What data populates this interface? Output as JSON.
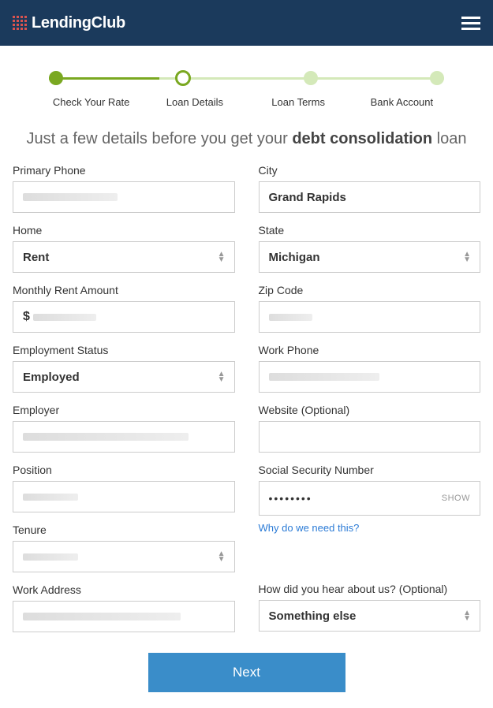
{
  "header": {
    "brand": "LendingClub"
  },
  "progress": {
    "steps": [
      "Check Your Rate",
      "Loan Details",
      "Loan Terms",
      "Bank Account"
    ]
  },
  "heading": {
    "prefix": "Just a few details before you get your ",
    "bold": "debt consolidation",
    "suffix": " loan"
  },
  "left": {
    "phone_label": "Primary Phone",
    "home_label": "Home",
    "home_value": "Rent",
    "rent_label": "Monthly Rent Amount",
    "rent_prefix": "$",
    "emp_status_label": "Employment Status",
    "emp_status_value": "Employed",
    "employer_label": "Employer",
    "position_label": "Position",
    "tenure_label": "Tenure",
    "work_addr_label": "Work Address"
  },
  "right": {
    "city_label": "City",
    "city_value": "Grand Rapids",
    "state_label": "State",
    "state_value": "Michigan",
    "zip_label": "Zip Code",
    "work_phone_label": "Work Phone",
    "website_label": "Website (Optional)",
    "ssn_label": "Social Security Number",
    "ssn_value": "••••••••",
    "ssn_show": "SHOW",
    "ssn_help": "Why do we need this?",
    "hear_label": "How did you hear about us? (Optional)",
    "hear_value": "Something else"
  },
  "cta": {
    "next": "Next"
  }
}
